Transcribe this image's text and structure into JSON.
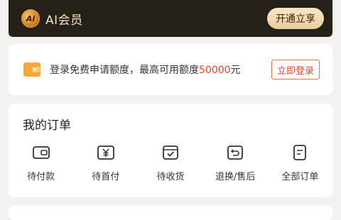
{
  "vip": {
    "logo_text": "Ai",
    "title": "AI会员",
    "button": "开通立享"
  },
  "credit": {
    "text": "登录免费申请额度，最高可用额度",
    "amount": "50000",
    "unit": "元",
    "button": "立即登录",
    "icon": "wallet-icon"
  },
  "orders": {
    "title": "我的订单",
    "items": [
      {
        "label": "待付款",
        "icon": "wallet-payment-icon"
      },
      {
        "label": "待首付",
        "icon": "yuan-icon"
      },
      {
        "label": "待收货",
        "icon": "package-check-icon"
      },
      {
        "label": "退换/售后",
        "icon": "return-icon"
      },
      {
        "label": "全部订单",
        "icon": "document-list-icon"
      }
    ]
  },
  "colors": {
    "vip_bg": "#262118",
    "vip_text": "#f4e2c1",
    "accent_red": "#e2452f",
    "wallet_orange": "#f3a93a"
  }
}
